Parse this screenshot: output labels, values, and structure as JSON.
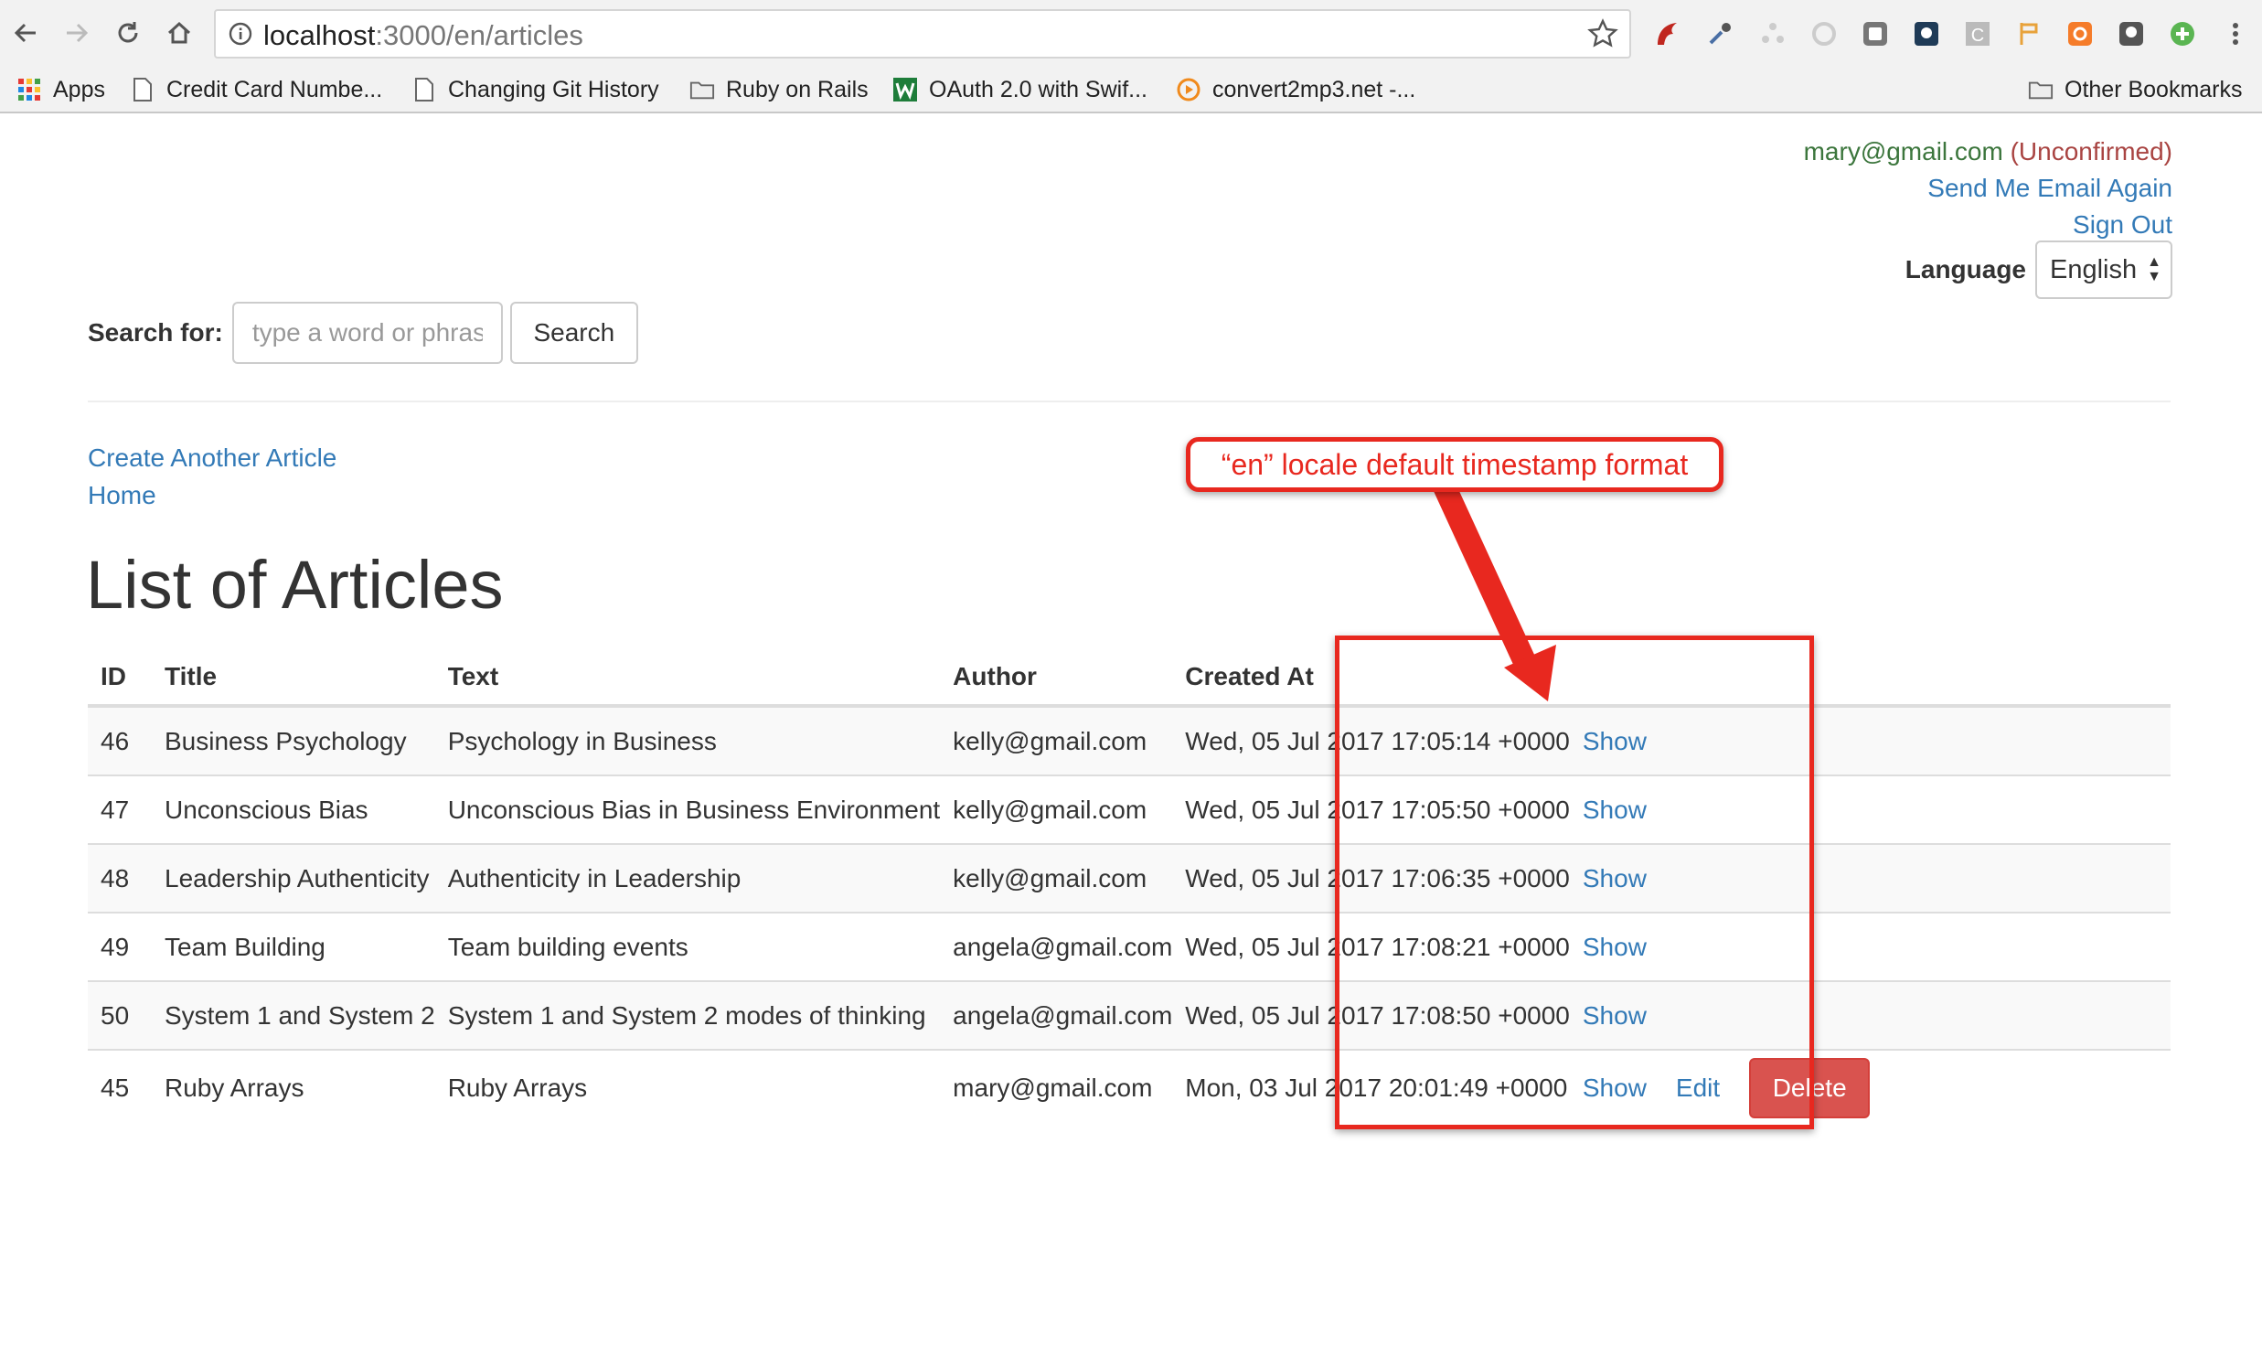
{
  "browser": {
    "url_host": "localhost",
    "url_rest": ":3000/en/articles",
    "bookmarks": [
      {
        "label": "Apps",
        "icon": "apps-grid-icon"
      },
      {
        "label": "Credit Card Numbe...",
        "icon": "page-icon"
      },
      {
        "label": "Changing Git History",
        "icon": "page-icon"
      },
      {
        "label": "Ruby on Rails",
        "icon": "folder-icon"
      },
      {
        "label": "OAuth 2.0 with Swif...",
        "icon": "site-favicon-icon"
      },
      {
        "label": "convert2mp3.net -...",
        "icon": "site-favicon-icon"
      }
    ],
    "other_bookmarks": "Other Bookmarks"
  },
  "user": {
    "email": "mary@gmail.com",
    "status": "(Unconfirmed)",
    "resend_link": "Send Me Email Again",
    "sign_out_link": "Sign Out"
  },
  "language": {
    "label": "Language",
    "selected": "English"
  },
  "search": {
    "label": "Search for:",
    "placeholder": "type a word or phrase",
    "button": "Search"
  },
  "nav": {
    "create_link": "Create Another Article",
    "home_link": "Home"
  },
  "page_title": "List of Articles",
  "table": {
    "headers": [
      "ID",
      "Title",
      "Text",
      "Author",
      "Created At",
      ""
    ],
    "rows": [
      {
        "id": "46",
        "title": "Business Psychology",
        "text": "Psychology in Business",
        "author": "kelly@gmail.com",
        "created_at": "Wed, 05 Jul 2017 17:05:14 +0000",
        "show": "Show"
      },
      {
        "id": "47",
        "title": "Unconscious Bias",
        "text": "Unconscious Bias in Business Environment",
        "author": "kelly@gmail.com",
        "created_at": "Wed, 05 Jul 2017 17:05:50 +0000",
        "show": "Show"
      },
      {
        "id": "48",
        "title": "Leadership Authenticity",
        "text": "Authenticity in Leadership",
        "author": "kelly@gmail.com",
        "created_at": "Wed, 05 Jul 2017 17:06:35 +0000",
        "show": "Show"
      },
      {
        "id": "49",
        "title": "Team Building",
        "text": "Team building events",
        "author": "angela@gmail.com",
        "created_at": "Wed, 05 Jul 2017 17:08:21 +0000",
        "show": "Show"
      },
      {
        "id": "50",
        "title": "System 1 and System 2",
        "text": "System 1 and System 2 modes of thinking",
        "author": "angela@gmail.com",
        "created_at": "Wed, 05 Jul 2017 17:08:50 +0000",
        "show": "Show"
      },
      {
        "id": "45",
        "title": "Ruby Arrays",
        "text": "Ruby Arrays",
        "author": "mary@gmail.com",
        "created_at": "Mon, 03 Jul 2017 20:01:49 +0000",
        "show": "Show",
        "edit": "Edit",
        "delete": "Delete"
      }
    ]
  },
  "annotation": {
    "label": "“en” locale default timestamp format",
    "color": "#e8281f"
  },
  "colors": {
    "link": "#337ab7",
    "email": "#3c763d",
    "unconfirmed": "#a94442",
    "danger": "#d9534f"
  }
}
